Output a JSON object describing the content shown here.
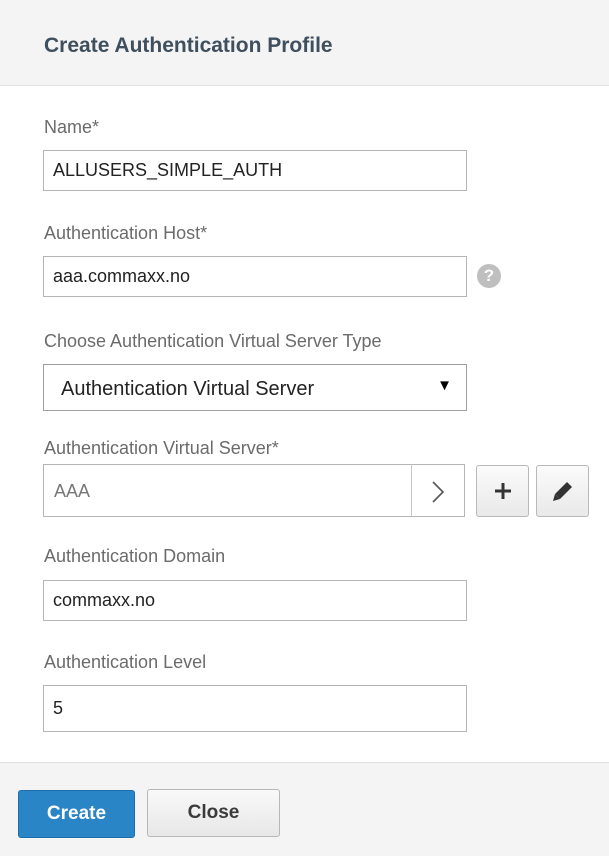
{
  "dialog": {
    "title": "Create Authentication Profile"
  },
  "fields": {
    "name": {
      "label": "Name*",
      "value": "ALLUSERS_SIMPLE_AUTH"
    },
    "host": {
      "label": "Authentication Host*",
      "value": "aaa.commaxx.no",
      "help_icon": "question-mark-icon"
    },
    "server_type": {
      "label": "Choose Authentication Virtual Server Type",
      "selected": "Authentication Virtual Server"
    },
    "virtual_server": {
      "label": "Authentication Virtual Server*",
      "value": "AAA"
    },
    "domain": {
      "label": "Authentication Domain",
      "value": "commaxx.no"
    },
    "level": {
      "label": "Authentication Level",
      "value": "5"
    }
  },
  "help": {
    "glyph": "?"
  },
  "select_caret": "▼",
  "footer": {
    "create_label": "Create",
    "close_label": "Close"
  },
  "colors": {
    "primary": "#2a85c6",
    "title": "#3f4f5e",
    "label": "#6b6b6b"
  }
}
